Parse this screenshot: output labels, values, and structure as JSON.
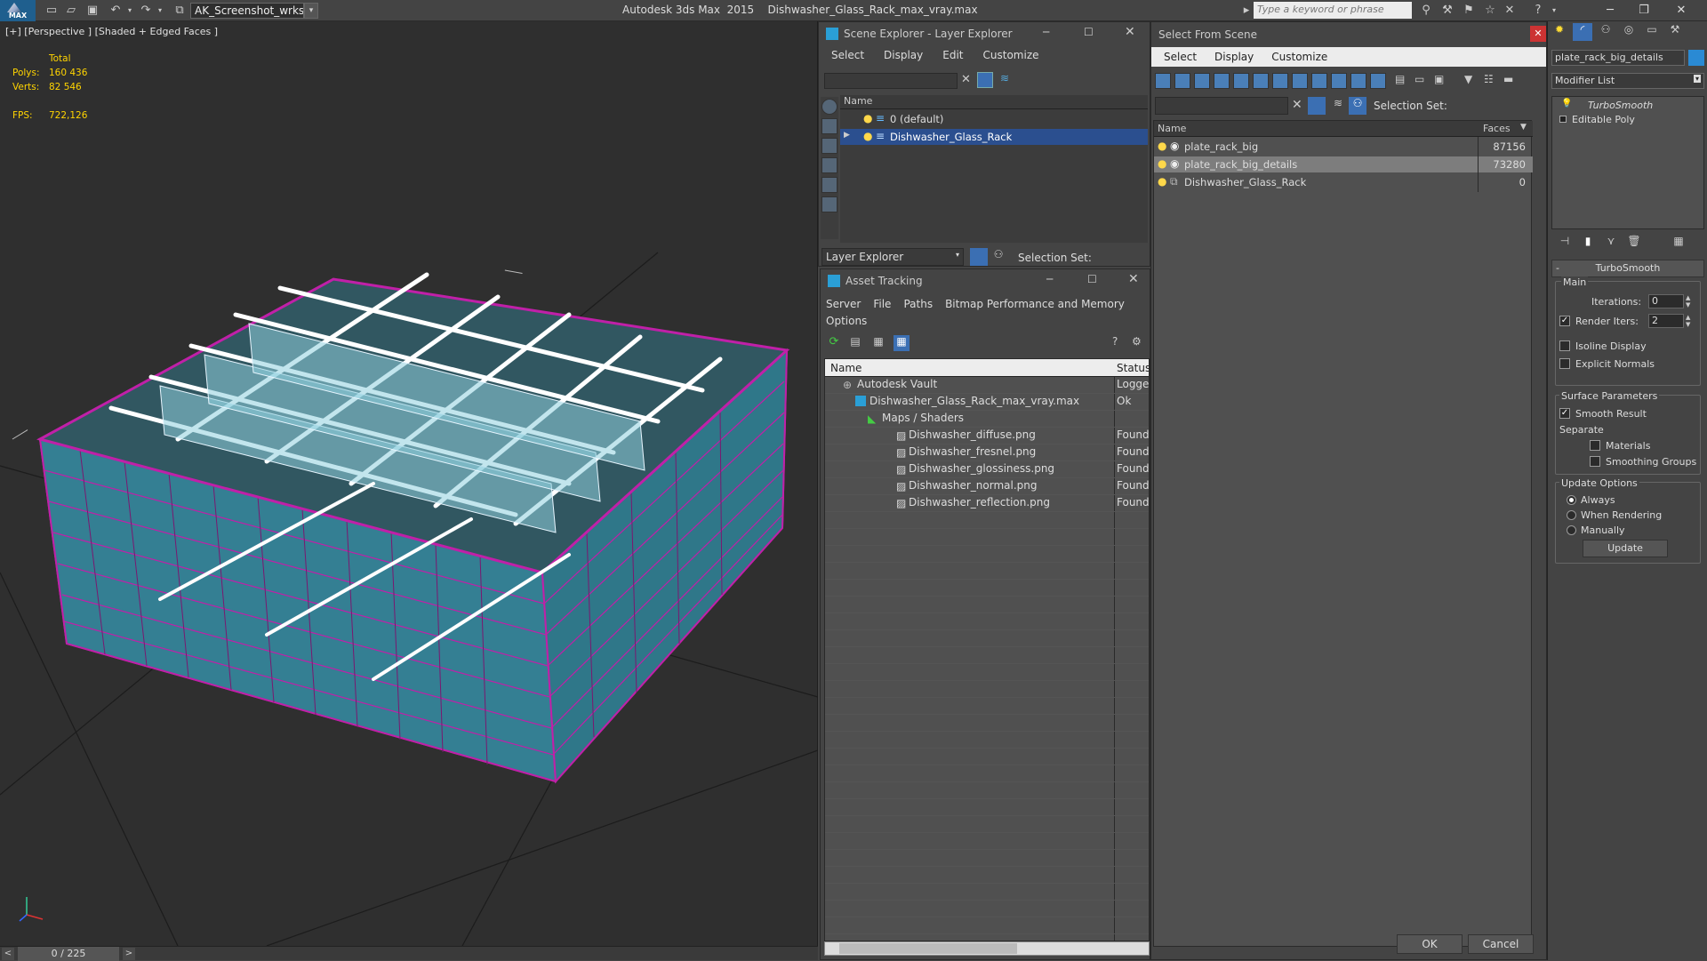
{
  "app": {
    "logo_text": "MAX",
    "workspace": "AK_Screenshot_wrksp",
    "product": "Autodesk 3ds Max  2015",
    "filename": "Dishwasher_Glass_Rack_max_vray.max",
    "search_placeholder": "Type a keyword or phrase"
  },
  "viewport": {
    "label": "[+] [Perspective ] [Shaded + Edged Faces ]",
    "stats": {
      "total_label": "Total",
      "polys_label": "Polys:",
      "polys": "160 436",
      "verts_label": "Verts:",
      "verts": "82 546",
      "fps_label": "FPS:",
      "fps": "722,126"
    },
    "timeline": "0 / 225",
    "colors": {
      "mesh": "#3b8fa5",
      "wire": "#c020a8",
      "selected": "#ffffff",
      "grid": "#1a1a1a"
    }
  },
  "scene_explorer": {
    "title": "Scene Explorer - Layer Explorer",
    "menus": [
      "Select",
      "Display",
      "Edit",
      "Customize"
    ],
    "column": "Name",
    "layers": [
      "0 (default)",
      "Dishwasher_Glass_Rack"
    ],
    "footer_dropdown": "Layer Explorer",
    "selection_set": "Selection Set:"
  },
  "asset_tracking": {
    "title": "Asset Tracking",
    "menus": [
      "Server",
      "File",
      "Paths",
      "Bitmap Performance and Memory"
    ],
    "menus2": [
      "Options"
    ],
    "columns": [
      "Name",
      "Status"
    ],
    "rows": [
      {
        "name": "Autodesk Vault",
        "status": "Logge"
      },
      {
        "name": "Dishwasher_Glass_Rack_max_vray.max",
        "status": "Ok"
      },
      {
        "name": "Maps / Shaders",
        "status": ""
      },
      {
        "name": "Dishwasher_diffuse.png",
        "status": "Found"
      },
      {
        "name": "Dishwasher_fresnel.png",
        "status": "Found"
      },
      {
        "name": "Dishwasher_glossiness.png",
        "status": "Found"
      },
      {
        "name": "Dishwasher_normal.png",
        "status": "Found"
      },
      {
        "name": "Dishwasher_reflection.png",
        "status": "Found"
      }
    ]
  },
  "select_from_scene": {
    "title": "Select From Scene",
    "menus": [
      "Select",
      "Display",
      "Customize"
    ],
    "selection_set": "Selection Set:",
    "columns": [
      "Name",
      "Faces"
    ],
    "rows": [
      {
        "name": "plate_rack_big",
        "faces": "87156"
      },
      {
        "name": "plate_rack_big_details",
        "faces": "73280"
      },
      {
        "name": "Dishwasher_Glass_Rack",
        "faces": "0"
      }
    ],
    "ok": "OK",
    "cancel": "Cancel"
  },
  "command_panel": {
    "object_name": "plate_rack_big_details",
    "modifier_list": "Modifier List",
    "stack": [
      "TurboSmooth",
      "Editable Poly"
    ],
    "rollout_title": "TurboSmooth",
    "main_label": "Main",
    "iterations_label": "Iterations:",
    "iterations": "0",
    "render_iters_label": "Render Iters:",
    "render_iters": "2",
    "isoline": "Isoline Display",
    "explicit": "Explicit Normals",
    "surface_label": "Surface Parameters",
    "smooth_result": "Smooth Result",
    "separate_label": "Separate",
    "materials": "Materials",
    "smoothing_groups": "Smoothing Groups",
    "update_label": "Update Options",
    "always": "Always",
    "when_rendering": "When Rendering",
    "manually": "Manually",
    "update_btn": "Update"
  }
}
